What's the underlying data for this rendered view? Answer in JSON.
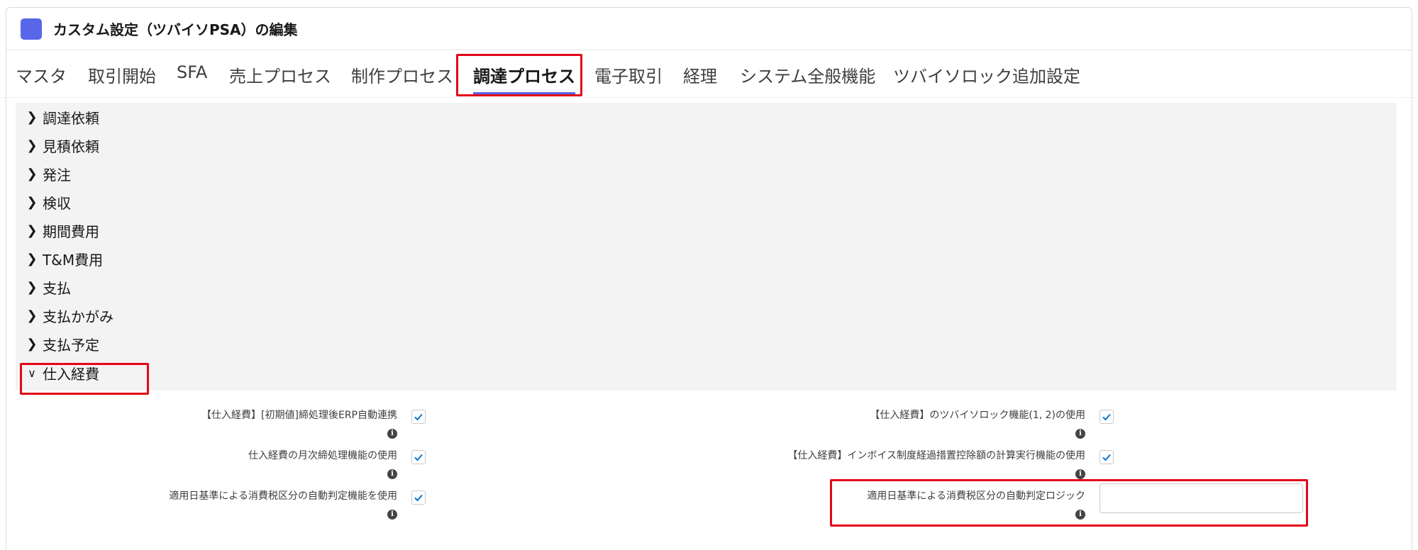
{
  "header": {
    "title": "カスタム設定（ツバイソPSA）の編集",
    "icon_color": "#5867e8"
  },
  "tabs": [
    {
      "label": "マスタ"
    },
    {
      "label": "取引開始"
    },
    {
      "label": "SFA"
    },
    {
      "label": "売上プロセス"
    },
    {
      "label": "制作プロセス"
    },
    {
      "label": "調達プロセス",
      "active": true
    },
    {
      "label": "電子取引"
    },
    {
      "label": "経理"
    },
    {
      "label": "システム全般機能"
    },
    {
      "label": "ツバイソロック追加設定"
    }
  ],
  "sections": [
    {
      "label": "調達依頼",
      "expanded": false
    },
    {
      "label": "見積依頼",
      "expanded": false
    },
    {
      "label": "発注",
      "expanded": false
    },
    {
      "label": "検収",
      "expanded": false
    },
    {
      "label": "期間費用",
      "expanded": false
    },
    {
      "label": "T&M費用",
      "expanded": false
    },
    {
      "label": "支払",
      "expanded": false
    },
    {
      "label": "支払かがみ",
      "expanded": false
    },
    {
      "label": "支払予定",
      "expanded": false
    },
    {
      "label": "仕入経費",
      "expanded": true
    }
  ],
  "fields": {
    "left": [
      {
        "label": "【仕入経費】[初期値]締処理後ERP自動連携",
        "checked": true
      },
      {
        "label": "仕入経費の月次締処理機能の使用",
        "checked": true
      },
      {
        "label": "適用日基準による消費税区分の自動判定機能を使用",
        "checked": true
      }
    ],
    "right": [
      {
        "label": "【仕入経費】のツバイソロック機能(1, 2)の使用",
        "checked": true
      },
      {
        "label": "【仕入経費】インボイス制度経過措置控除額の計算実行機能の使用",
        "checked": true
      },
      {
        "label": "適用日基準による消費税区分の自動判定ロジック",
        "value": ""
      }
    ]
  },
  "colors": {
    "highlight": "#e4061b",
    "section_bg": "#f3f3f3",
    "check": "#0176d3"
  }
}
